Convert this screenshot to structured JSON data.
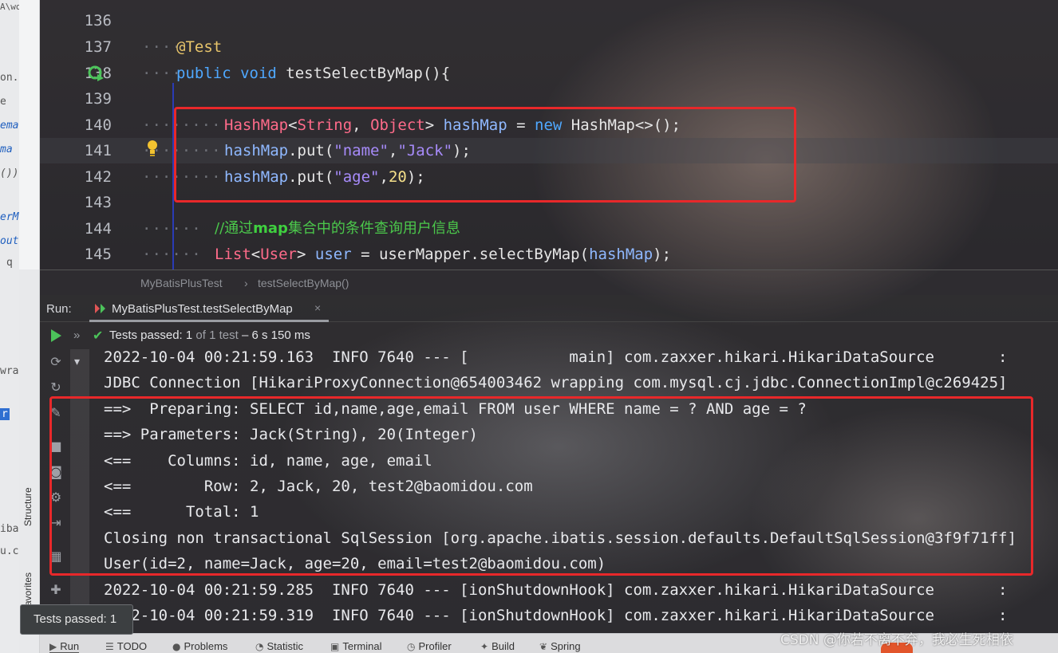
{
  "left_strip": {
    "fragments": [
      "A\\wo",
      "on.j",
      "e",
      "ema",
      "ma",
      "());",
      "erM",
      "out",
      "q",
      "wra",
      "r",
      "iba",
      "u.c"
    ]
  },
  "side_tabs": {
    "structure": "Structure",
    "favorites": "avorites"
  },
  "editor": {
    "lines": [
      {
        "num": "136"
      },
      {
        "num": "137"
      },
      {
        "num": "138"
      },
      {
        "num": "139"
      },
      {
        "num": "140"
      },
      {
        "num": "141"
      },
      {
        "num": "142"
      },
      {
        "num": "143"
      },
      {
        "num": "144"
      },
      {
        "num": "145"
      }
    ],
    "code": {
      "l137": "@Test",
      "l138_kw": "public void ",
      "l138_fn": "testSelectByMap(){",
      "l140_t1": "HashMap",
      "l140_p1": "<",
      "l140_t2": "String",
      "l140_p2": ", ",
      "l140_t3": "Object",
      "l140_p3": "> ",
      "l140_v": "hashMap",
      "l140_p4": " = ",
      "l140_kw": "new",
      "l140_p5": " HashMap<>();",
      "l141_v": "hashMap",
      "l141_p1": ".put(",
      "l141_s1": "\"name\"",
      "l141_p2": ",",
      "l141_s2": "\"Jack\"",
      "l141_p3": ");",
      "l142_v": "hashMap",
      "l142_p1": ".put(",
      "l142_s1": "\"age\"",
      "l142_p2": ",",
      "l142_n": "20",
      "l142_p3": ");",
      "l144_c1": "//通过",
      "l144_c2": "map",
      "l144_c3": "集合中的条件查询用户信息",
      "l145_t1": "List",
      "l145_p1": "<",
      "l145_t2": "User",
      "l145_p2": "> ",
      "l145_v1": "user",
      "l145_p3": " = ",
      "l145_p4": "userMapper.selectByMap(",
      "l145_v2": "hashMap",
      "l145_p5": ");"
    }
  },
  "breadcrumb": {
    "class": "MyBatisPlusTest",
    "sep": "›",
    "method": "testSelectByMap()"
  },
  "run_panel": {
    "label": "Run:",
    "tab": "MyBatisPlusTest.testSelectByMap",
    "close": "×",
    "status_prefix": "»",
    "status_passed": "Tests passed: ",
    "status_count": "1",
    "status_of": " of 1 test",
    "status_time": " – 6 s 150 ms"
  },
  "console": {
    "lines": [
      "2022-10-04 00:21:59.163  INFO 7640 --- [           main] com.zaxxer.hikari.HikariDataSource       :",
      "JDBC Connection [HikariProxyConnection@654003462 wrapping com.mysql.cj.jdbc.ConnectionImpl@c269425]",
      "==>  Preparing: SELECT id,name,age,email FROM user WHERE name = ? AND age = ?",
      "==> Parameters: Jack(String), 20(Integer)",
      "<==    Columns: id, name, age, email",
      "<==        Row: 2, Jack, 20, test2@baomidou.com",
      "<==      Total: 1",
      "Closing non transactional SqlSession [org.apache.ibatis.session.defaults.DefaultSqlSession@3f9f71ff]",
      "User(id=2, name=Jack, age=20, email=test2@baomidou.com)",
      "2022-10-04 00:21:59.285  INFO 7640 --- [ionShutdownHook] com.zaxxer.hikari.HikariDataSource       :",
      "2022-10-04 00:21:59.319  INFO 7640 --- [ionShutdownHook] com.zaxxer.hikari.HikariDataSource       :"
    ]
  },
  "tooltip": {
    "text": "Tests passed: 1"
  },
  "bottom_bar": {
    "run": "Run",
    "todo": "TODO",
    "problems": "Problems",
    "statistic": "Statistic",
    "terminal": "Terminal",
    "profiler": "Profiler",
    "build": "Build",
    "spring": "Spring"
  },
  "watermark": {
    "text": "CSDN @你若不离不弃，我必生死相依"
  },
  "colors": {
    "keyword": "#4fa8ff",
    "type": "#ff6b8a",
    "string": "#a78bfa",
    "number": "#f5e08a",
    "comment": "#4bc84b",
    "highlight_box": "#e8282a",
    "pass_green": "#4cc35a"
  }
}
